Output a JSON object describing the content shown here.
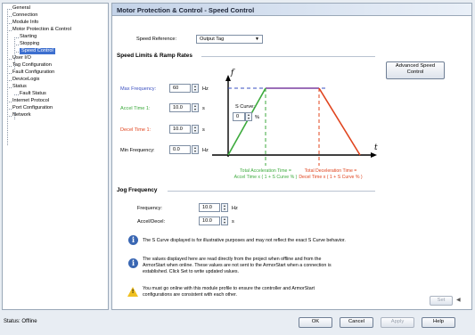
{
  "nav": {
    "items": [
      {
        "label": "General",
        "selected": false
      },
      {
        "label": "Connection",
        "selected": false
      },
      {
        "label": "Module Info",
        "selected": false
      },
      {
        "label": "Motor Protection & Control",
        "selected": false
      },
      {
        "label": "Starting",
        "selected": false
      },
      {
        "label": "Stopping",
        "selected": false
      },
      {
        "label": "Speed Control",
        "selected": true
      },
      {
        "label": "User I/O",
        "selected": false
      },
      {
        "label": "Tag Configuration",
        "selected": false
      },
      {
        "label": "Fault Configuration",
        "selected": false
      },
      {
        "label": "DeviceLogix",
        "selected": false
      },
      {
        "label": "Status",
        "selected": false
      },
      {
        "label": "Fault Status",
        "selected": false
      },
      {
        "label": "Internet Protocol",
        "selected": false
      },
      {
        "label": "Port Configuration",
        "selected": false
      },
      {
        "label": "Network",
        "selected": false
      }
    ]
  },
  "header": {
    "title": "Motor Protection & Control - Speed Control"
  },
  "speed_reference": {
    "label": "Speed Reference:",
    "value": "Output Tag"
  },
  "limits": {
    "section_title": "Speed Limits & Ramp Rates",
    "advanced_button": "Advanced Speed Control",
    "max_freq": {
      "label": "Max Frequency:",
      "value": "60",
      "unit": "Hz"
    },
    "accel": {
      "label": "Accel Time 1:",
      "value": "10.0",
      "unit": "s"
    },
    "decel": {
      "label": "Decel Time 1:",
      "value": "10.0",
      "unit": "s"
    },
    "min_freq": {
      "label": "Min Frequency:",
      "value": "0.0",
      "unit": "Hz"
    },
    "s_curve": {
      "label": "S Curve:",
      "value": "0",
      "unit": "%"
    }
  },
  "graph": {
    "f_axis": "f",
    "t_axis": "t",
    "accel_caption_1": "Total Acceleration Time =",
    "accel_caption_2": "Accel Time x ( 1 + S Curve % )",
    "decel_caption_1": "Total Deceleration Time =",
    "decel_caption_2": "Decel Time x ( 1 + S Curve % )",
    "colors": {
      "max": "#3a4fc0",
      "accel": "#3caa3c",
      "decel": "#e0441e",
      "plateau": "#7a3fa0"
    }
  },
  "jog": {
    "section_title": "Jog Frequency",
    "frequency": {
      "label": "Frequency:",
      "value": "10.0",
      "unit": "Hz"
    },
    "accel_decel": {
      "label": "Accel/Decel:",
      "value": "10.0",
      "unit": "s"
    }
  },
  "notes": {
    "note1": "The S Curve displayed is for illustrative purposes and may not reflect the exact S Curve behavior.",
    "note2_line1": "The values displayed here are read directly from the project when offline and from the",
    "note2_line2": "ArmorStart when online.  These values are not sent to the ArmorStart when a connection is",
    "note2_line3": "established.  Click Set to write updated values.",
    "warn_line1": "You must go online with this module profile to ensure the controller and ArmorStart",
    "warn_line2": "configurations are consistent with each other."
  },
  "set_button": "Set",
  "footer": {
    "status": "Status:  Offline",
    "ok": "OK",
    "cancel": "Cancel",
    "apply": "Apply",
    "help": "Help"
  }
}
